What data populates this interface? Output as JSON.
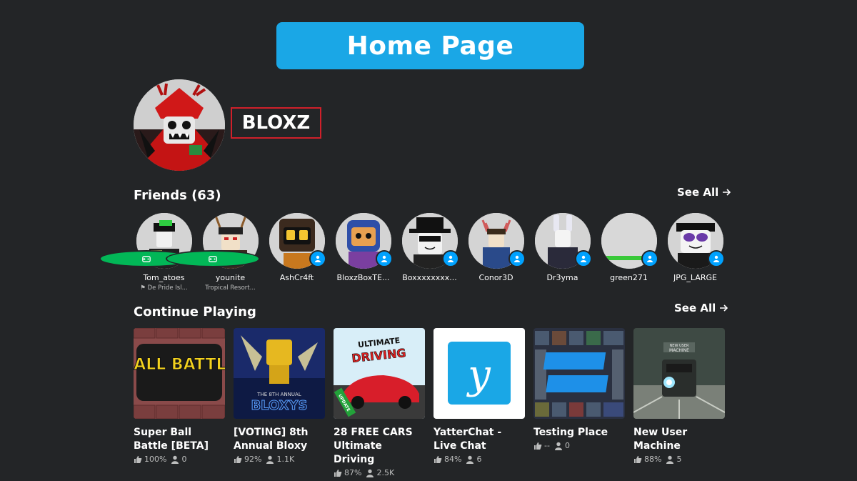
{
  "banner": {
    "title": "Home Page"
  },
  "profile": {
    "username": "BLOXZ"
  },
  "friends": {
    "title": "Friends (63)",
    "see_all": "See All",
    "items": [
      {
        "name": "Tom_atoes",
        "sub": "De Pride Isl...",
        "status": "game"
      },
      {
        "name": "younite",
        "sub": "Tropical Resort...",
        "status": "game"
      },
      {
        "name": "AshCr4ft",
        "sub": "",
        "status": "online"
      },
      {
        "name": "BloxzBoxTE...",
        "sub": "",
        "status": "online"
      },
      {
        "name": "Boxxxxxxxx...",
        "sub": "",
        "status": "online"
      },
      {
        "name": "Conor3D",
        "sub": "",
        "status": "online"
      },
      {
        "name": "Dr3yma",
        "sub": "",
        "status": "online"
      },
      {
        "name": "green271",
        "sub": "",
        "status": "online"
      },
      {
        "name": "JPG_LARGE",
        "sub": "",
        "status": "online"
      }
    ]
  },
  "continue_playing": {
    "title": "Continue Playing",
    "see_all": "See All",
    "games": [
      {
        "title": "Super Ball Battle [BETA]",
        "rating": "100%",
        "players": "0",
        "thumb_text": "BALL BATTLE"
      },
      {
        "title": "[VOTING] 8th Annual Bloxy",
        "rating": "92%",
        "players": "1.1K",
        "thumb_text": "BLOXYS",
        "thumb_sub": "THE 8TH ANNUAL"
      },
      {
        "title": "28 FREE CARS Ultimate Driving",
        "rating": "87%",
        "players": "2.5K",
        "thumb_text": "ULTIMATE DRIVING",
        "thumb_badge": "UPDATE"
      },
      {
        "title": "YatterChat - Live Chat",
        "rating": "84%",
        "players": "6",
        "thumb_text": "y"
      },
      {
        "title": "Testing Place",
        "rating": "--",
        "players": "0"
      },
      {
        "title": "New User Machine",
        "rating": "88%",
        "players": "5",
        "thumb_text": "NEW USER MACHINE"
      }
    ]
  },
  "colors": {
    "background": "#232527",
    "banner": "#1aa7e6",
    "highlight_border": "#d0202a",
    "in_game": "#02b757",
    "online": "#00a2ff"
  }
}
